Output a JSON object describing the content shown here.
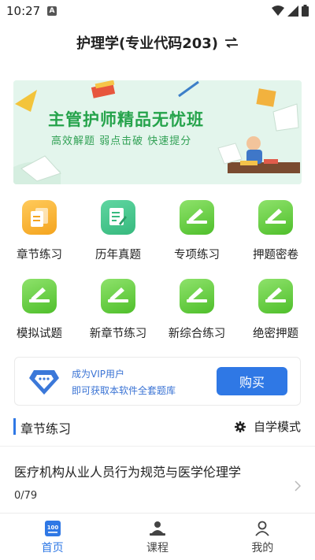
{
  "status_bar": {
    "time": "10:27",
    "badge": "A"
  },
  "header": {
    "title": "护理学(专业代码203)",
    "switch_icon": "swap-arrows-icon"
  },
  "banner": {
    "title": "主管护师精品无忧班",
    "subtitle": "高效解题 弱点击破 快速提分"
  },
  "grid": [
    {
      "label": "章节练习",
      "icon": "document-icon",
      "color": "#f6ab2a"
    },
    {
      "label": "历年真题",
      "icon": "exam-paper-icon",
      "color": "#43c08a"
    },
    {
      "label": "专项练习",
      "icon": "pencil-icon",
      "color": "#5ec53a"
    },
    {
      "label": "押题密卷",
      "icon": "pencil-icon",
      "color": "#5ec53a"
    },
    {
      "label": "模拟试题",
      "icon": "pencil-icon",
      "color": "#5ec53a"
    },
    {
      "label": "新章节练习",
      "icon": "pencil-icon",
      "color": "#5ec53a"
    },
    {
      "label": "新综合练习",
      "icon": "pencil-icon",
      "color": "#5ec53a"
    },
    {
      "label": "绝密押题",
      "icon": "pencil-icon",
      "color": "#5ec53a"
    }
  ],
  "vip": {
    "line1": "成为VIP用户",
    "line2": "即可获取本软件全套题库",
    "button": "购买",
    "accent": "#2f78e5"
  },
  "section": {
    "title": "章节练习",
    "mode": "自学模式"
  },
  "chapter": {
    "title": "医疗机构从业人员行为规范与医学伦理学",
    "progress": "0/79"
  },
  "nav": [
    {
      "label": "首页",
      "icon": "home-100-icon",
      "active": true
    },
    {
      "label": "课程",
      "icon": "course-icon",
      "active": false
    },
    {
      "label": "我的",
      "icon": "person-icon",
      "active": false
    }
  ]
}
